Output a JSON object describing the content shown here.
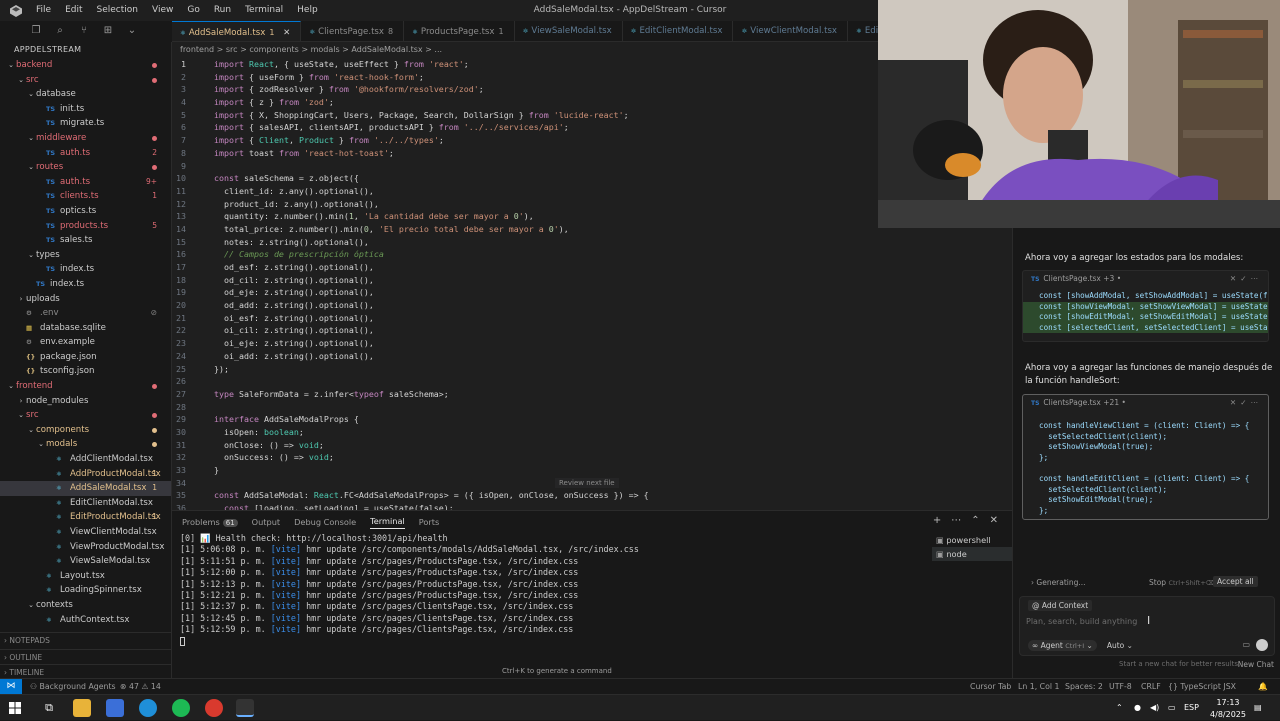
{
  "window": {
    "title": "AddSaleModal.tsx - AppDelStream - Cursor",
    "menu": [
      "File",
      "Edit",
      "Selection",
      "View",
      "Go",
      "Run",
      "Terminal",
      "Help"
    ]
  },
  "explorer": {
    "root": "APPDELSTREAM",
    "rows": [
      {
        "label": "backend",
        "kind": "folder-open",
        "indent": 0,
        "color": "red",
        "dot": "#e06c75"
      },
      {
        "label": "src",
        "kind": "folder-open",
        "indent": 1,
        "color": "red",
        "dot": "#e06c75"
      },
      {
        "label": "database",
        "kind": "folder-open",
        "indent": 2,
        "color": "white"
      },
      {
        "label": "init.ts",
        "kind": "ts",
        "indent": 3,
        "color": "white"
      },
      {
        "label": "migrate.ts",
        "kind": "ts",
        "indent": 3,
        "color": "white"
      },
      {
        "label": "middleware",
        "kind": "folder-open",
        "indent": 2,
        "color": "red",
        "dot": "#e06c75"
      },
      {
        "label": "auth.ts",
        "kind": "ts",
        "indent": 3,
        "color": "red",
        "badge": "2"
      },
      {
        "label": "routes",
        "kind": "folder-open",
        "indent": 2,
        "color": "red",
        "dot": "#e06c75"
      },
      {
        "label": "auth.ts",
        "kind": "ts",
        "indent": 3,
        "color": "red",
        "badge": "9+"
      },
      {
        "label": "clients.ts",
        "kind": "ts",
        "indent": 3,
        "color": "red",
        "badge": "1"
      },
      {
        "label": "optics.ts",
        "kind": "ts",
        "indent": 3,
        "color": "white"
      },
      {
        "label": "products.ts",
        "kind": "ts",
        "indent": 3,
        "color": "red",
        "badge": "5"
      },
      {
        "label": "sales.ts",
        "kind": "ts",
        "indent": 3,
        "color": "white"
      },
      {
        "label": "types",
        "kind": "folder-open",
        "indent": 2,
        "color": "white"
      },
      {
        "label": "index.ts",
        "kind": "ts",
        "indent": 3,
        "color": "white"
      },
      {
        "label": "index.ts",
        "kind": "ts",
        "indent": 2,
        "color": "white"
      },
      {
        "label": "uploads",
        "kind": "folder-closed",
        "indent": 1,
        "color": "white"
      },
      {
        "label": ".env",
        "kind": "gear",
        "indent": 1,
        "color": "grey",
        "badge": "⊘"
      },
      {
        "label": "database.sqlite",
        "kind": "db",
        "indent": 1,
        "color": "white"
      },
      {
        "label": "env.example",
        "kind": "gear",
        "indent": 1,
        "color": "white"
      },
      {
        "label": "package.json",
        "kind": "json",
        "indent": 1,
        "color": "white"
      },
      {
        "label": "tsconfig.json",
        "kind": "json",
        "indent": 1,
        "color": "white"
      },
      {
        "label": "frontend",
        "kind": "folder-open",
        "indent": 0,
        "color": "red",
        "dot": "#e06c75"
      },
      {
        "label": "node_modules",
        "kind": "folder-closed",
        "indent": 1,
        "color": "white"
      },
      {
        "label": "src",
        "kind": "folder-open",
        "indent": 1,
        "color": "red",
        "dot": "#e06c75"
      },
      {
        "label": "components",
        "kind": "folder-open",
        "indent": 2,
        "color": "yellow",
        "dot": "#e2c08d"
      },
      {
        "label": "modals",
        "kind": "folder-open",
        "indent": 3,
        "color": "yellow",
        "dot": "#e2c08d"
      },
      {
        "label": "AddClientModal.tsx",
        "kind": "react",
        "indent": 4,
        "color": "white"
      },
      {
        "label": "AddProductModal.tsx",
        "kind": "react",
        "indent": 4,
        "color": "yellow",
        "badge": "1"
      },
      {
        "label": "AddSaleModal.tsx",
        "kind": "react",
        "indent": 4,
        "color": "yellow",
        "badge": "1",
        "selected": true
      },
      {
        "label": "EditClientModal.tsx",
        "kind": "react",
        "indent": 4,
        "color": "white"
      },
      {
        "label": "EditProductModal.tsx",
        "kind": "react",
        "indent": 4,
        "color": "yellow",
        "badge": "1"
      },
      {
        "label": "ViewClientModal.tsx",
        "kind": "react",
        "indent": 4,
        "color": "white"
      },
      {
        "label": "ViewProductModal.tsx",
        "kind": "react",
        "indent": 4,
        "color": "white"
      },
      {
        "label": "ViewSaleModal.tsx",
        "kind": "react",
        "indent": 4,
        "color": "white"
      },
      {
        "label": "Layout.tsx",
        "kind": "react",
        "indent": 3,
        "color": "white"
      },
      {
        "label": "LoadingSpinner.tsx",
        "kind": "react",
        "indent": 3,
        "color": "white"
      },
      {
        "label": "contexts",
        "kind": "folder-open",
        "indent": 2,
        "color": "white"
      },
      {
        "label": "AuthContext.tsx",
        "kind": "react",
        "indent": 3,
        "color": "white"
      }
    ],
    "footer": [
      "NOTEPADS",
      "OUTLINE",
      "TIMELINE"
    ]
  },
  "tabs": [
    {
      "label": "AddSaleModal.tsx",
      "count": "1",
      "active": true
    },
    {
      "label": "ClientsPage.tsx",
      "count": "8"
    },
    {
      "label": "ProductsPage.tsx",
      "count": "1"
    },
    {
      "label": "ViewSaleModal.tsx",
      "dim": true
    },
    {
      "label": "EditClientModal.tsx",
      "dim": true
    },
    {
      "label": "ViewClientModal.tsx",
      "dim": true
    },
    {
      "label": "Edi",
      "dim": true
    }
  ],
  "breadcrumb": "frontend  >  src  >  components  >  modals  >  AddSaleModal.tsx  >  ...",
  "editor": {
    "lines": [
      {
        "n": "1",
        "t": "import React, { useState, useEffect } from 'react';"
      },
      {
        "n": "2",
        "t": "import { useForm } from 'react-hook-form';"
      },
      {
        "n": "3",
        "t": "import { zodResolver } from '@hookform/resolvers/zod';"
      },
      {
        "n": "4",
        "t": "import { z } from 'zod';"
      },
      {
        "n": "5",
        "t": "import { X, ShoppingCart, Users, Package, Search, DollarSign } from 'lucide-react';"
      },
      {
        "n": "6",
        "t": "import { salesAPI, clientsAPI, productsAPI } from '../../services/api';"
      },
      {
        "n": "7",
        "t": "import { Client, Product } from '../../types';"
      },
      {
        "n": "8",
        "t": "import toast from 'react-hot-toast';"
      },
      {
        "n": "9",
        "t": ""
      },
      {
        "n": "10",
        "t": "const saleSchema = z.object({"
      },
      {
        "n": "11",
        "t": "  client_id: z.any().optional(),"
      },
      {
        "n": "12",
        "t": "  product_id: z.any().optional(),"
      },
      {
        "n": "13",
        "t": "  quantity: z.number().min(1, 'La cantidad debe ser mayor a 0'),"
      },
      {
        "n": "14",
        "t": "  total_price: z.number().min(0, 'El precio total debe ser mayor a 0'),"
      },
      {
        "n": "15",
        "t": "  notes: z.string().optional(),"
      },
      {
        "n": "16",
        "t": "  // Campos de prescripción óptica"
      },
      {
        "n": "17",
        "t": "  od_esf: z.string().optional(),"
      },
      {
        "n": "18",
        "t": "  od_cil: z.string().optional(),"
      },
      {
        "n": "19",
        "t": "  od_eje: z.string().optional(),"
      },
      {
        "n": "20",
        "t": "  od_add: z.string().optional(),"
      },
      {
        "n": "21",
        "t": "  oi_esf: z.string().optional(),"
      },
      {
        "n": "22",
        "t": "  oi_cil: z.string().optional(),"
      },
      {
        "n": "23",
        "t": "  oi_eje: z.string().optional(),"
      },
      {
        "n": "24",
        "t": "  oi_add: z.string().optional(),"
      },
      {
        "n": "25",
        "t": "});"
      },
      {
        "n": "26",
        "t": ""
      },
      {
        "n": "27",
        "t": "type SaleFormData = z.infer<typeof saleSchema>;"
      },
      {
        "n": "28",
        "t": ""
      },
      {
        "n": "29",
        "t": "interface AddSaleModalProps {"
      },
      {
        "n": "30",
        "t": "  isOpen: boolean;"
      },
      {
        "n": "31",
        "t": "  onClose: () => void;"
      },
      {
        "n": "32",
        "t": "  onSuccess: () => void;"
      },
      {
        "n": "33",
        "t": "}"
      },
      {
        "n": "34",
        "t": ""
      },
      {
        "n": "35",
        "t": "const AddSaleModal: React.FC<AddSaleModalProps> = ({ isOpen, onClose, onSuccess }) => {"
      },
      {
        "n": "36",
        "t": "  const [loading, setLoading] = useState(false);"
      }
    ],
    "review_hint": "Review next file"
  },
  "panel": {
    "tabs": [
      {
        "label": "Problems",
        "badge": "61"
      },
      {
        "label": "Output"
      },
      {
        "label": "Debug Console"
      },
      {
        "label": "Terminal",
        "active": true
      },
      {
        "label": "Ports"
      }
    ],
    "terminal_lines": [
      {
        "pre": "[0] ",
        "mid": "📊 Health check: http://localhost:3001/api/health",
        "post": ""
      },
      {
        "pre": "[1] 5:06:08 p. m. ",
        "mid": "[vite]",
        "post": " hmr update /src/components/modals/AddSaleModal.tsx, /src/index.css"
      },
      {
        "pre": "[1] 5:11:51 p. m. ",
        "mid": "[vite]",
        "post": " hmr update /src/pages/ProductsPage.tsx, /src/index.css"
      },
      {
        "pre": "[1] 5:12:00 p. m. ",
        "mid": "[vite]",
        "post": " hmr update /src/pages/ProductsPage.tsx, /src/index.css"
      },
      {
        "pre": "[1] 5:12:13 p. m. ",
        "mid": "[vite]",
        "post": " hmr update /src/pages/ProductsPage.tsx, /src/index.css"
      },
      {
        "pre": "[1] 5:12:21 p. m. ",
        "mid": "[vite]",
        "post": " hmr update /src/pages/ProductsPage.tsx, /src/index.css"
      },
      {
        "pre": "[1] 5:12:37 p. m. ",
        "mid": "[vite]",
        "post": " hmr update /src/pages/ClientsPage.tsx, /src/index.css"
      },
      {
        "pre": "[1] 5:12:45 p. m. ",
        "mid": "[vite]",
        "post": " hmr update /src/pages/ClientsPage.tsx, /src/index.css"
      },
      {
        "pre": "[1] 5:12:59 p. m. ",
        "mid": "[vite]",
        "post": " hmr update /src/pages/ClientsPage.tsx, /src/index.css"
      }
    ],
    "terminals": [
      "powershell",
      "node"
    ],
    "hint": "Ctrl+K to generate a command"
  },
  "chat": {
    "msg1": "Ahora voy a agregar los estados para los modales:",
    "card1": {
      "file": "ClientsPage.tsx",
      "diff": "+3",
      "lines": [
        {
          "t": "const [showAddModal, setShowAddModal] = useState(fal",
          "hl": false
        },
        {
          "t": "const [showViewModal, setShowViewModal] = useState(f",
          "hl": true
        },
        {
          "t": "const [showEditModal, setShowEditModal] = useState(f",
          "hl": true
        },
        {
          "t": "const [selectedClient, setSelectedClient] = useState",
          "hl": true
        }
      ]
    },
    "msg2": "Ahora voy a agregar las funciones de manejo después de la función handleSort:",
    "card2": {
      "file": "ClientsPage.tsx",
      "diff": "+21",
      "lines": [
        {
          "t": "const handleViewClient = (client: Client) => {"
        },
        {
          "t": "  setSelectedClient(client);"
        },
        {
          "t": "  setShowViewModal(true);"
        },
        {
          "t": "};"
        },
        {
          "t": ""
        },
        {
          "t": "const handleEditClient = (client: Client) => {"
        },
        {
          "t": "  setSelectedClient(client);"
        },
        {
          "t": "  setShowEditModal(true);"
        },
        {
          "t": "};"
        }
      ]
    },
    "generating": "Generating...",
    "stop": "Stop",
    "stop_keys": "Ctrl+Shift+⌫",
    "accept_all": "Accept all",
    "add_context": "Add Context",
    "placeholder": "Plan, search, build anything",
    "agent": "Agent",
    "agent_keys": "Ctrl+I",
    "model": "Auto",
    "footer_hint": "Start a new chat for better results.",
    "new_chat": "New Chat"
  },
  "statusbar": {
    "agents": "Background Agents",
    "errors": "47",
    "warnings": "14",
    "cursor_tab": "Cursor Tab",
    "position": "Ln 1, Col 1",
    "spaces": "Spaces: 2",
    "encoding": "UTF-8",
    "eol": "CRLF",
    "language": "TypeScript JSX"
  },
  "taskbar": {
    "lang": "ESP",
    "time": "17:13",
    "date": "4/8/2025"
  }
}
